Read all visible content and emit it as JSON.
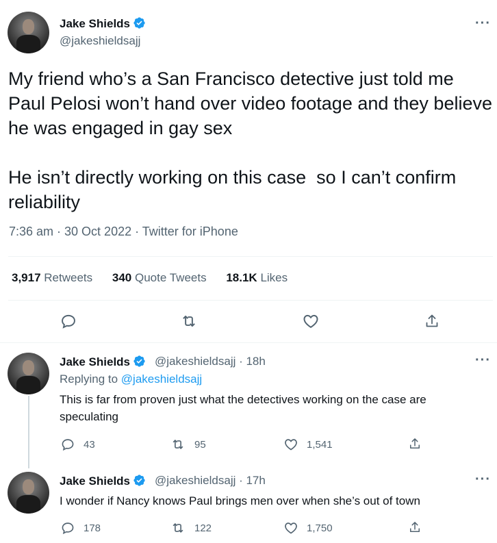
{
  "main_tweet": {
    "author_name": "Jake Shields",
    "author_handle": "@jakeshieldsajj",
    "text": "My friend who’s a San Francisco detective just told me Paul Pelosi won’t hand over video footage and they believe he was engaged in gay sex\n\nHe isn’t directly working on this case  so I can’t confirm reliability",
    "meta": "7:36 am · 30 Oct 2022 · Twitter for iPhone",
    "stats": {
      "retweets_count": "3,917",
      "retweets_label": "Retweets",
      "quotes_count": "340",
      "quotes_label": "Quote Tweets",
      "likes_count": "18.1K",
      "likes_label": "Likes"
    }
  },
  "replies": [
    {
      "author_name": "Jake Shields",
      "author_handle_time": "@jakeshieldsajj · 18h",
      "replying_prefix": "Replying to ",
      "replying_to": "@jakeshieldsajj",
      "text": "This is far from proven just what the detectives working on the case are speculating",
      "reply_count": "43",
      "retweet_count": "95",
      "like_count": "1,541"
    },
    {
      "author_name": "Jake Shields",
      "author_handle_time": "@jakeshieldsajj · 17h",
      "text": "I wonder if Nancy knows Paul brings men over when she’s out of town",
      "reply_count": "178",
      "retweet_count": "122",
      "like_count": "1,750"
    }
  ],
  "more_glyph": "···",
  "colors": {
    "accent": "#1d9bf0",
    "text": "#0f1419",
    "secondary": "#536471",
    "divider": "#eff3f4"
  }
}
